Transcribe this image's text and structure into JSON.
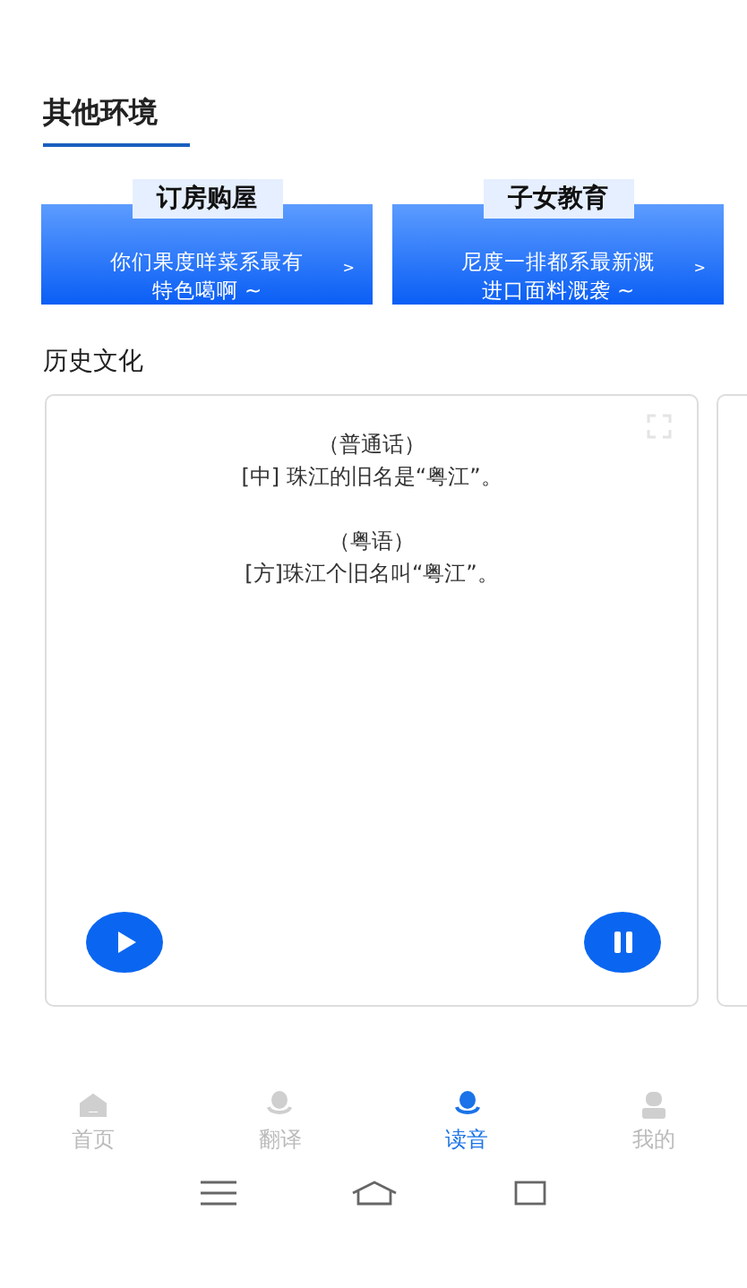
{
  "section_title": "其他环境",
  "promo_cards": [
    {
      "title": "订房购屋",
      "text": "你们果度咩菜系最有特色噶啊 ~",
      "arrow": ">"
    },
    {
      "title": "子女教育",
      "text": "尼度一排都系最新溉进口面料溉袭 ~",
      "arrow": ">"
    }
  ],
  "history": {
    "title": "历史文化",
    "lines": [
      {
        "kind": "label",
        "text": "（普通话）"
      },
      {
        "kind": "sentence",
        "text": "[中] 珠江的旧名是“粤江”。"
      },
      {
        "kind": "gap"
      },
      {
        "kind": "label",
        "text": "（粤语）"
      },
      {
        "kind": "sentence",
        "text": "[方]珠江个旧名叫“粤江”。"
      }
    ]
  },
  "tabs": [
    {
      "label": "首页",
      "selected": false
    },
    {
      "label": "翻译",
      "selected": false
    },
    {
      "label": "读音",
      "selected": true
    },
    {
      "label": "我的",
      "selected": false
    }
  ]
}
